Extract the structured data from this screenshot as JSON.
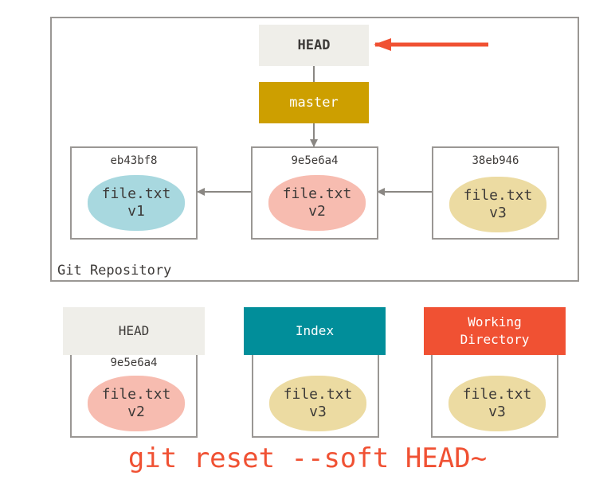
{
  "repository": {
    "label": "Git Repository",
    "head_ref": "HEAD",
    "branch_ref": "master",
    "commits": [
      {
        "sha": "eb43bf8",
        "file": "file.txt",
        "version": "v1",
        "color": "#a8d8df"
      },
      {
        "sha": "9e5e6a4",
        "file": "file.txt",
        "version": "v2",
        "color": "#f7bcb0"
      },
      {
        "sha": "38eb946",
        "file": "file.txt",
        "version": "v3",
        "color": "#ecdba2"
      }
    ]
  },
  "trees": [
    {
      "title": "HEAD",
      "sha": "9e5e6a4",
      "file": "file.txt",
      "version": "v2",
      "header_color": "#efeee9",
      "blob_color": "#f7bcb0"
    },
    {
      "title": "Index",
      "sha": "",
      "file": "file.txt",
      "version": "v3",
      "header_color": "#018e9a",
      "blob_color": "#ecdba2"
    },
    {
      "title": "Working\nDirectory",
      "sha": "",
      "file": "file.txt",
      "version": "v3",
      "header_color": "#f05133",
      "blob_color": "#ecdba2"
    }
  ],
  "command": "git reset --soft HEAD~",
  "colors": {
    "accent_arrow": "#f05133",
    "border": "#9a9794"
  }
}
